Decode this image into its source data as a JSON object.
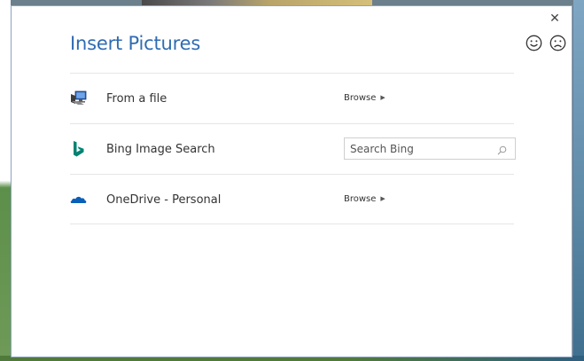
{
  "dialog": {
    "title": "Insert Pictures",
    "close_label": "✕",
    "feedback": {
      "smile_icon": "smile-icon",
      "frown_icon": "frown-icon"
    }
  },
  "sources": [
    {
      "icon": "computer-icon",
      "label": "From a file",
      "action_label": "Browse"
    },
    {
      "icon": "bing-icon",
      "label": "Bing Image Search",
      "search_placeholder": "Search Bing",
      "search_value": ""
    },
    {
      "icon": "onedrive-icon",
      "label": "OneDrive - Personal",
      "action_label": "Browse"
    }
  ],
  "colors": {
    "title": "#2f6cb3",
    "bing": "#008373",
    "onedrive": "#0a5fb8",
    "border": "#8aa3c2"
  }
}
